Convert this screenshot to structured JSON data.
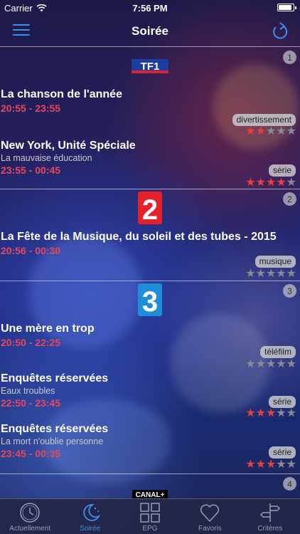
{
  "status_bar": {
    "carrier": "Carrier",
    "time": "7:56 PM",
    "battery_level": 0.9
  },
  "nav": {
    "title": "Soirée"
  },
  "channels": [
    {
      "number": "1",
      "logo_text": "TF1",
      "programs": [
        {
          "title": "La chanson de l'année",
          "subtitle": "",
          "time": "20:55 - 23:55",
          "genre": "divertissement",
          "rating": 2
        },
        {
          "title": "New York, Unité Spéciale",
          "subtitle": "La mauvaise éducation",
          "time": "23:55 - 00:45",
          "genre": "série",
          "rating": 4
        }
      ]
    },
    {
      "number": "2",
      "logo_text": "2",
      "programs": [
        {
          "title": "La Fête de la Musique, du soleil et des tubes - 2015",
          "subtitle": "",
          "time": "20:56 - 00:30",
          "genre": "musique",
          "rating": 0
        }
      ]
    },
    {
      "number": "3",
      "logo_text": "3",
      "programs": [
        {
          "title": "Une mère en trop",
          "subtitle": "",
          "time": "20:50 - 22:25",
          "genre": "téléfilm",
          "rating": 0
        },
        {
          "title": "Enquêtes réservées",
          "subtitle": "Eaux troubles",
          "time": "22:50 - 23:45",
          "genre": "série",
          "rating": 3
        },
        {
          "title": "Enquêtes réservées",
          "subtitle": "La mort n'oublie personne",
          "time": "23:45 - 00:35",
          "genre": "série",
          "rating": 3
        }
      ]
    },
    {
      "number": "4",
      "logo_text": "CANAL+",
      "programs": []
    }
  ],
  "tabs": [
    {
      "label": "Actuellement",
      "icon": "clock-icon",
      "active": false
    },
    {
      "label": "Soirée",
      "icon": "moon-icon",
      "active": true
    },
    {
      "label": "EPG",
      "icon": "grid-icon",
      "active": false
    },
    {
      "label": "Favoris",
      "icon": "heart-icon",
      "active": false
    },
    {
      "label": "Critères",
      "icon": "signpost-icon",
      "active": false
    }
  ],
  "colors": {
    "accent": "#3d8fe8",
    "time": "#e8475a",
    "star_on": "#e84040",
    "star_off": "#8a8a95"
  }
}
